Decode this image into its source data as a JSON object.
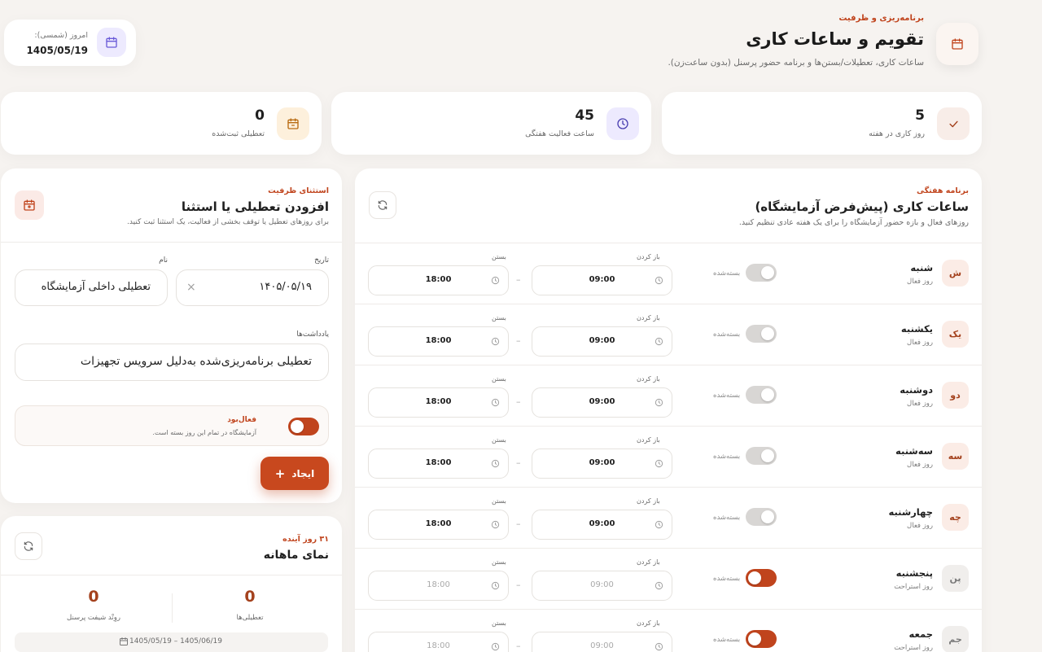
{
  "header": {
    "eyebrow": "برنامه‌ریزی و ظرفیت",
    "title": "تقویم و ساعات کاری",
    "subtitle": "ساعات کاری، تعطیلات/بستن‌ها و برنامه حضور پرسنل (بدون ساعت‌زن)."
  },
  "today": {
    "label": "امروز (شمسی):",
    "value": "1405/05/19"
  },
  "stats": [
    {
      "value": "5",
      "caption": "روز کاری در هفته"
    },
    {
      "value": "45",
      "caption": "ساعت فعالیت هفتگی"
    },
    {
      "value": "0",
      "caption": "تعطیلی ثبت‌شده"
    }
  ],
  "weekly": {
    "eyebrow": "برنامه هفتگی",
    "title": "ساعات کاری (پیش‌فرض آزمایشگاه)",
    "subtitle": "روزهای فعال و بازه حضور آزمایشگاه را برای یک هفته عادی تنظیم کنید.",
    "open_label": "باز کردن",
    "close_label": "بستن",
    "closed_label": "بسته‌شده",
    "days": [
      {
        "badge": "ش",
        "name": "شنبه",
        "type": "روز فعال",
        "closed": false,
        "open": "09:00",
        "close": "18:00"
      },
      {
        "badge": "یک",
        "name": "یکشنبه",
        "type": "روز فعال",
        "closed": false,
        "open": "09:00",
        "close": "18:00"
      },
      {
        "badge": "دو",
        "name": "دوشنبه",
        "type": "روز فعال",
        "closed": false,
        "open": "09:00",
        "close": "18:00"
      },
      {
        "badge": "سه",
        "name": "سه‌شنبه",
        "type": "روز فعال",
        "closed": false,
        "open": "09:00",
        "close": "18:00"
      },
      {
        "badge": "چه",
        "name": "چهارشنبه",
        "type": "روز فعال",
        "closed": false,
        "open": "09:00",
        "close": "18:00"
      },
      {
        "badge": "پن",
        "name": "پنجشنبه",
        "type": "روز استراحت",
        "closed": true,
        "open": "09:00",
        "close": "18:00"
      },
      {
        "badge": "جم",
        "name": "جمعه",
        "type": "روز استراحت",
        "closed": true,
        "open": "09:00",
        "close": "18:00"
      }
    ]
  },
  "holiday_form": {
    "eyebrow": "استثنای ظرفیت",
    "title": "افزودن تعطیلی یا استثنا",
    "subtitle": "برای روزهای تعطیل یا توقف بخشی از فعالیت، یک استثنا ثبت کنید.",
    "date_label": "تاریخ",
    "date_value": "۱۴۰۵/۰۵/۱۹",
    "name_label": "نام",
    "name_value": "تعطیلی داخلی آزمایشگاه",
    "notes_label": "یادداشت‌ها",
    "notes_value": "تعطیلی برنامه‌ریزی‌شده به‌دلیل سرویس تجهیزات",
    "active_title": "فعال‌بود",
    "active_desc": "آزمایشگاه در تمام این روز بسته است.",
    "create_label": "ایجاد"
  },
  "monthly": {
    "eyebrow": "۳۱ روز آینده",
    "title": "نمای ماهانه",
    "stats": [
      {
        "value": "0",
        "caption": "تعطیلی‌ها"
      },
      {
        "value": "0",
        "caption": "روِنْد شیفت پرسنل"
      }
    ],
    "range": "1405/05/19 – 1405/06/19"
  },
  "colors": {
    "accent": "#c0441d",
    "background": "#f6f3f0"
  }
}
